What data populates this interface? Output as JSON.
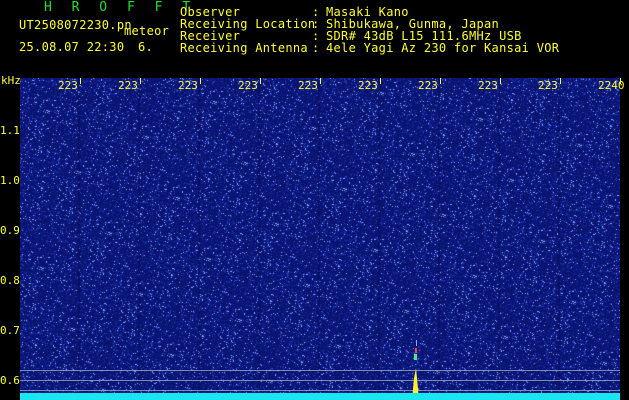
{
  "header": {
    "program_title": "H R O F F T",
    "file_name": "UT2508072230.pn",
    "mode": "meteor",
    "timestamp": "25.08.07 22:30",
    "count": "6.",
    "info": [
      {
        "label": "Observer",
        "value": "Masaki Kano"
      },
      {
        "label": "Receiving Location",
        "value": "Shibukawa, Gunma, Japan"
      },
      {
        "label": "Receiver",
        "value": "SDR# 43dB L15 111.6MHz USB"
      },
      {
        "label": "Receiving Antenna",
        "value": "4ele Yagi Az 230 for Kansai VOR"
      }
    ],
    "colon": ":"
  },
  "axes": {
    "y_unit": "kHz",
    "y_ticks": [
      {
        "label": "1.1",
        "value": 1.1
      },
      {
        "label": "1.0",
        "value": 1.0
      },
      {
        "label": "0.9",
        "value": 0.9
      },
      {
        "label": "0.8",
        "value": 0.8
      },
      {
        "label": "0.7",
        "value": 0.7
      },
      {
        "label": "0.6",
        "value": 0.6
      }
    ],
    "x_ticks": [
      "223",
      "223",
      "223",
      "223",
      "223",
      "223",
      "223",
      "223",
      "223",
      "2240"
    ]
  },
  "colors": {
    "header_green": "#22dd33",
    "header_yellow": "#ffff33",
    "background_blue": "#0a1466",
    "baseline_cyan": "#19e6f0"
  }
}
